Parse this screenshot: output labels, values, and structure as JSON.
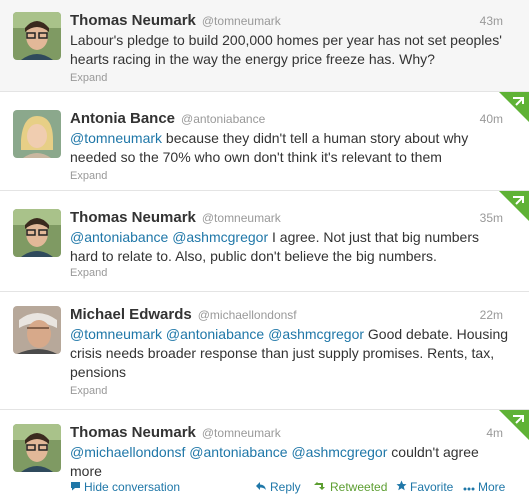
{
  "tweets": [
    {
      "name": "Thomas Neumark",
      "handle": "@tomneumark",
      "time": "43m",
      "text_parts": [
        {
          "type": "text",
          "value": "Labour's pledge to build 200,000 homes per year has not set peoples' hearts racing in the way the energy price freeze has. Why?"
        }
      ],
      "expand": "Expand"
    },
    {
      "name": "Antonia Bance",
      "handle": "@antoniabance",
      "time": "40m",
      "text_parts": [
        {
          "type": "mention",
          "value": "@tomneumark"
        },
        {
          "type": "text",
          "value": " because they didn't tell a human story about why needed so the 70% who own don't think it's relevant to them"
        }
      ],
      "expand": "Expand"
    },
    {
      "name": "Thomas Neumark",
      "handle": "@tomneumark",
      "time": "35m",
      "text_parts": [
        {
          "type": "mention",
          "value": "@antoniabance"
        },
        {
          "type": "text",
          "value": " "
        },
        {
          "type": "mention",
          "value": "@ashmcgregor"
        },
        {
          "type": "text",
          "value": "  I agree. Not just that big numbers hard to relate to. Also, public don't believe the big numbers."
        }
      ],
      "expand": "Expand"
    },
    {
      "name": "Michael Edwards",
      "handle": "@michaellondonsf",
      "time": "22m",
      "text_parts": [
        {
          "type": "mention",
          "value": "@tomneumark"
        },
        {
          "type": "text",
          "value": " "
        },
        {
          "type": "mention",
          "value": "@antoniabance"
        },
        {
          "type": "text",
          "value": " "
        },
        {
          "type": "mention",
          "value": "@ashmcgregor"
        },
        {
          "type": "text",
          "value": " Good debate. Housing crisis needs broader response than just supply promises. Rents, tax, pensions"
        }
      ],
      "expand": "Expand"
    },
    {
      "name": "Thomas Neumark",
      "handle": "@tomneumark",
      "time": "4m",
      "text_parts": [
        {
          "type": "mention",
          "value": "@michaellondonsf"
        },
        {
          "type": "text",
          "value": " "
        },
        {
          "type": "mention",
          "value": "@antoniabance"
        },
        {
          "type": "text",
          "value": " "
        },
        {
          "type": "mention",
          "value": "@ashmcgregor"
        },
        {
          "type": "text",
          "value": " couldn't agree more"
        }
      ],
      "expand": ""
    }
  ],
  "actions": {
    "hide_conversation": "Hide conversation",
    "reply": "Reply",
    "retweeted": "Retweeted",
    "favorite": "Favorite",
    "more": "More"
  },
  "colors": {
    "link": "#1f77a8",
    "retweeted": "#5c9e31",
    "corner_green": "#5fb236"
  },
  "icons": [
    "speech-bubble-icon",
    "reply-arrow-icon",
    "retweet-icon",
    "star-icon",
    "dots-icon",
    "retweet-corner-icon"
  ]
}
